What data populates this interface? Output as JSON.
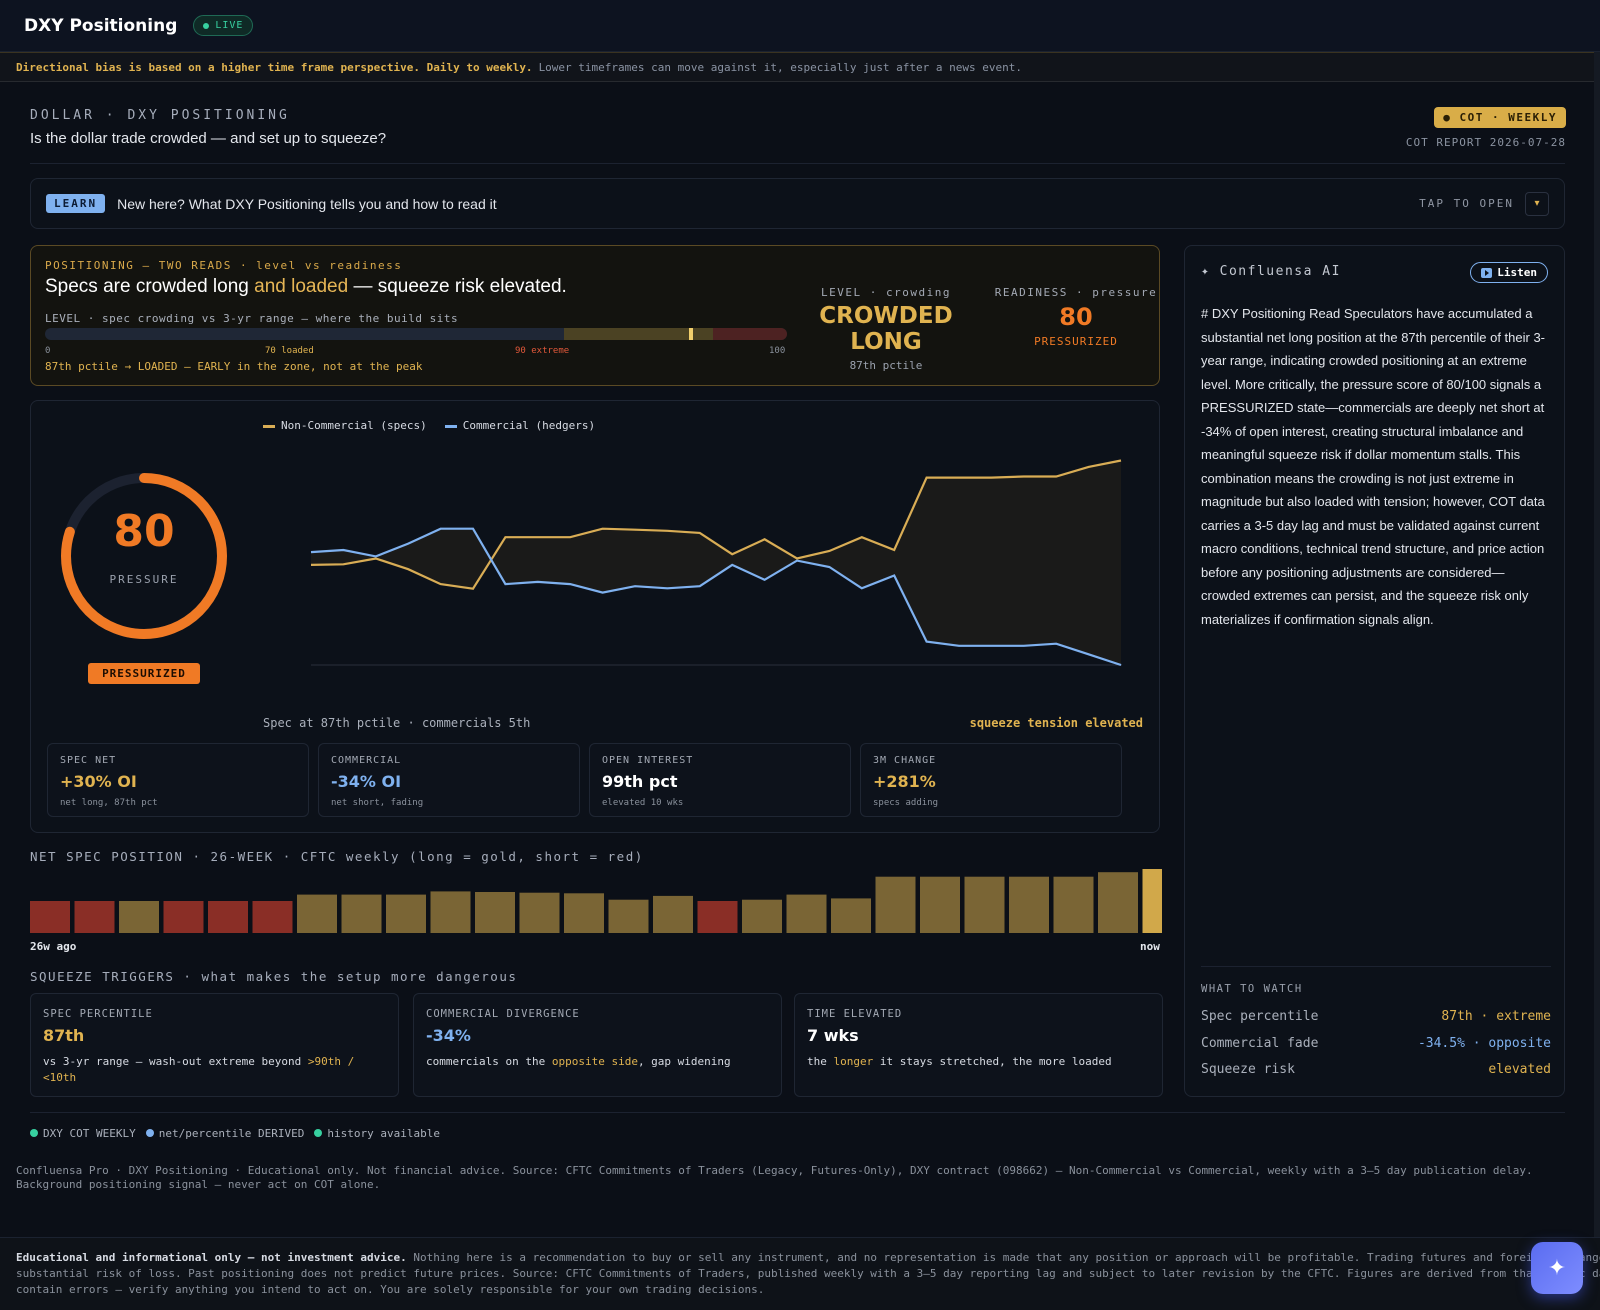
{
  "app": {
    "title": "DXY Positioning",
    "live": "LIVE"
  },
  "notice": {
    "bold": "Directional bias is based on a higher time frame perspective. Daily to weekly.",
    "rest": "Lower timeframes can move against it, especially just after a news event."
  },
  "header": {
    "kicker": "DOLLAR · DXY POSITIONING",
    "question": "Is the dollar trade crowded — and set up to squeeze?",
    "badge": "● COT · WEEKLY",
    "report_date": "COT REPORT 2026-07-28"
  },
  "learn": {
    "pill": "LEARN",
    "text": "New here? What DXY Positioning tells you and how to read it",
    "tap": "TAP TO OPEN",
    "chevron": "▾"
  },
  "reads": {
    "kicker": "POSITIONING — TWO READS · level vs readiness",
    "headline_a": "Specs are crowded long ",
    "headline_b": "and loaded",
    "headline_c": " — squeeze risk elevated.",
    "level_caption": "LEVEL · spec crowding vs 3-yr range — where the build sits",
    "ticks": {
      "t0": "0",
      "t70": "70 loaded",
      "t90": "90 extreme",
      "t100": "100"
    },
    "level_value_pct": 87,
    "note": "87th pctile → LOADED — EARLY in the zone, not at the peak",
    "level": {
      "head": "LEVEL · crowding",
      "value": "CROWDED LONG",
      "sub": "87th pctile"
    },
    "readiness": {
      "head": "READINESS · pressure",
      "value": "80",
      "sub": "PRESSURIZED"
    }
  },
  "pressure": {
    "value": "80",
    "max": 100,
    "label": "PRESSURE",
    "state": "PRESSURIZED"
  },
  "legend": {
    "spec": "Non-Commercial (specs)",
    "comm": "Commercial (hedgers)"
  },
  "chart_caption": "Spec at 87th pctile · commercials 5th",
  "chart_tension": "squeeze tension elevated",
  "chart_data": {
    "type": "line",
    "series": [
      {
        "name": "Non-Commercial (specs)",
        "color": "#d9ad55",
        "values": [
          47,
          47.3,
          50,
          45,
          38,
          35.8,
          60,
          60,
          60,
          64,
          63.5,
          63,
          62,
          52,
          59,
          50,
          53.5,
          60,
          54,
          88,
          88,
          88,
          88.5,
          88.5,
          93,
          96
        ]
      },
      {
        "name": "Commercial (hedgers)",
        "color": "#7fb1ef",
        "values": [
          53,
          54,
          51,
          57,
          64,
          64,
          38,
          39,
          38,
          34,
          37,
          36,
          37,
          47,
          40,
          49,
          46,
          36,
          42,
          11,
          9,
          9,
          9,
          10,
          5,
          0
        ]
      }
    ],
    "ylim": [
      0,
      100
    ]
  },
  "stats": [
    {
      "label": "SPEC NET",
      "value": "+30% OI",
      "sub": "net long, 87th pct",
      "color": "#e0b350"
    },
    {
      "label": "COMMERCIAL",
      "value": "-34% OI",
      "sub": "net short, fading",
      "color": "#7fb1ef"
    },
    {
      "label": "OPEN INTEREST",
      "value": "99th pct",
      "sub": "elevated 10 wks",
      "color": "#ffffff"
    },
    {
      "label": "3M CHANGE",
      "value": "+281%",
      "sub": "specs adding",
      "color": "#e0b350"
    }
  ],
  "net_spec": {
    "title": "NET SPEC POSITION · 26-WEEK · CFTC weekly (long = gold, short = red)",
    "left_label": "26w ago",
    "right_label": "now",
    "bars": [
      {
        "dir": "short",
        "level": 50
      },
      {
        "dir": "short",
        "level": 50
      },
      {
        "dir": "long",
        "level": 50
      },
      {
        "dir": "short",
        "level": 50
      },
      {
        "dir": "short",
        "level": 50
      },
      {
        "dir": "short",
        "level": 50
      },
      {
        "dir": "long",
        "level": 60
      },
      {
        "dir": "long",
        "level": 60
      },
      {
        "dir": "long",
        "level": 60
      },
      {
        "dir": "long",
        "level": 65
      },
      {
        "dir": "long",
        "level": 64
      },
      {
        "dir": "long",
        "level": 63
      },
      {
        "dir": "long",
        "level": 62
      },
      {
        "dir": "long",
        "level": 52
      },
      {
        "dir": "long",
        "level": 58
      },
      {
        "dir": "short",
        "level": 50
      },
      {
        "dir": "long",
        "level": 52
      },
      {
        "dir": "long",
        "level": 60
      },
      {
        "dir": "long",
        "level": 54
      },
      {
        "dir": "long",
        "level": 88
      },
      {
        "dir": "long",
        "level": 88
      },
      {
        "dir": "long",
        "level": 88
      },
      {
        "dir": "long",
        "level": 88
      },
      {
        "dir": "long",
        "level": 88
      },
      {
        "dir": "long",
        "level": 95
      },
      {
        "dir": "long",
        "level": 100,
        "current": true
      }
    ],
    "colors": {
      "long": "#7a6535",
      "short": "#8a2e26",
      "current": "#d1a84a"
    }
  },
  "squeeze": {
    "title": "SQUEEZE TRIGGERS · what makes the setup more dangerous",
    "cards": [
      {
        "label": "SPEC PERCENTILE",
        "value": "87th",
        "color": "#e0b350",
        "desc_a": "vs 3-yr range — wash-out extreme beyond ",
        "desc_hl": ">90th / <10th",
        "desc_b": ""
      },
      {
        "label": "COMMERCIAL DIVERGENCE",
        "value": "-34%",
        "color": "#7fb1ef",
        "desc_a": "commercials on the ",
        "desc_hl": "opposite side",
        "desc_b": ", gap widening"
      },
      {
        "label": "TIME ELEVATED",
        "value": "7 wks",
        "color": "#ffffff",
        "desc_a": "the ",
        "desc_hl": "longer",
        "desc_b": " it stays stretched, the more loaded"
      }
    ]
  },
  "ai": {
    "title": "✦ Confluensa AI",
    "listen": "Listen",
    "body": "# DXY Positioning Read Speculators have accumulated a substantial net long position at the 87th percentile of their 3-year range, indicating crowded positioning at an extreme level. More critically, the pressure score of 80/100 signals a PRESSURIZED state—commercials are deeply net short at -34% of open interest, creating structural imbalance and meaningful squeeze risk if dollar momentum stalls. This combination means the crowding is not just extreme in magnitude but also loaded with tension; however, COT data carries a 3-5 day lag and must be validated against current macro conditions, technical trend structure, and price action before any positioning adjustments are considered—crowded extremes can persist, and the squeeze risk only materializes if confirmation signals align.",
    "watch_title": "WHAT TO WATCH",
    "watch": [
      {
        "k": "Spec percentile",
        "v": "87th · extreme",
        "color": "#e0b350"
      },
      {
        "k": "Commercial fade",
        "v": "-34.5% · opposite",
        "color": "#7fb1ef"
      },
      {
        "k": "Squeeze risk",
        "v": "elevated",
        "color": "#e0b350"
      }
    ]
  },
  "sources": [
    {
      "label": "DXY COT WEEKLY",
      "color": "#37d0a0"
    },
    {
      "label": "net/percentile DERIVED",
      "color": "#7fb1ef"
    },
    {
      "label": "history available",
      "color": "#37d0a0"
    }
  ],
  "disclaimer_1": "Confluensa Pro · DXY Positioning · Educational only. Not financial advice. Source: CFTC Commitments of Traders (Legacy, Futures-Only), DXY contract (098662) — Non-Commercial vs Commercial, weekly with a 3–5 day publication delay. Background positioning signal — never act on COT alone.",
  "footer": {
    "bold": "Educational and informational only — not investment advice.",
    "line1": "Nothing here is a recommendation to buy or sell any instrument, and no representation is made that any position or approach will be profitable. Trading futures and foreign exchange carries",
    "line2": "substantial risk of loss. Past positioning does not predict future prices. Source: CFTC Commitments of Traders, published weekly with a 3–5 day reporting lag and subject to later revision by the CFTC. Figures are derived from that public data and may",
    "line3": "contain errors — verify anything you intend to act on. You are solely responsible for your own trading decisions."
  },
  "fab": "✦"
}
